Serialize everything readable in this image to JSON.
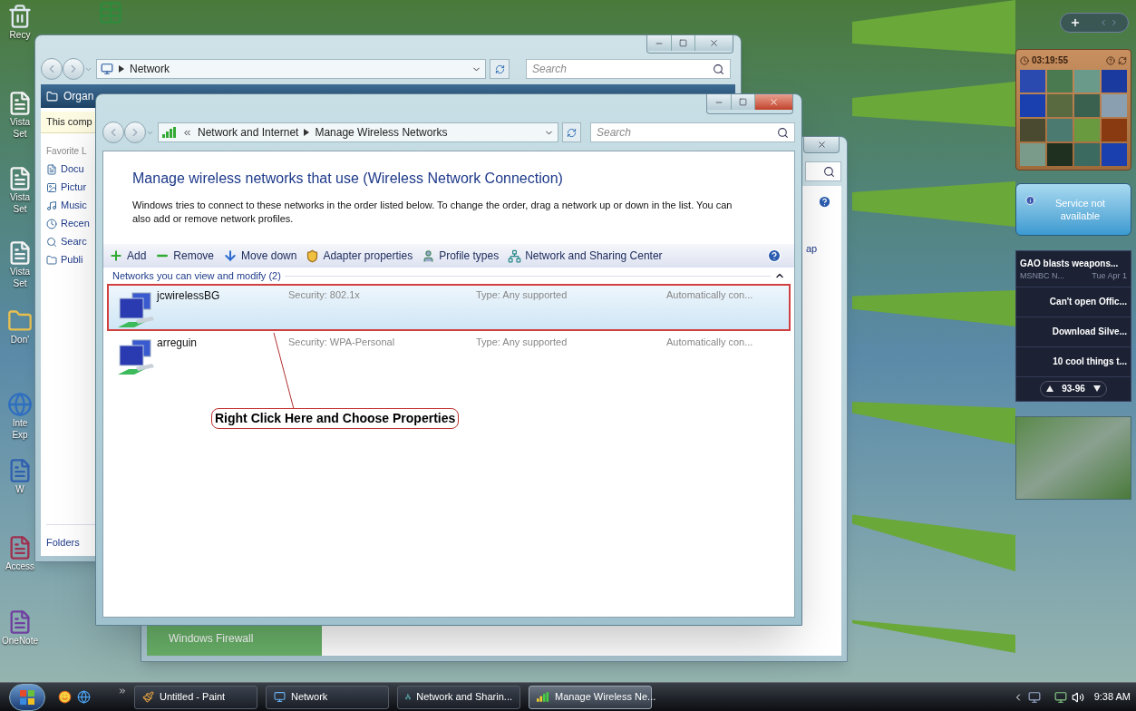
{
  "desktop_icons": [
    {
      "kind": "bin",
      "lines": [
        "Recy"
      ]
    },
    {
      "kind": "sheet"
    },
    {
      "kind": "file",
      "lines": [
        "Vista",
        "Set"
      ]
    },
    {
      "kind": "file",
      "lines": [
        "Vista",
        "Set"
      ]
    },
    {
      "kind": "file",
      "lines": [
        "Vista",
        "Set"
      ]
    },
    {
      "kind": "folder",
      "lines": [
        "Don'"
      ]
    },
    {
      "kind": "browser",
      "lines": [
        "Inte",
        "Exp"
      ]
    },
    {
      "kind": "word",
      "lines": [
        "W"
      ]
    },
    {
      "kind": "access",
      "lines": [
        "Access"
      ]
    },
    {
      "kind": "onenote",
      "lines": [
        "OneNote"
      ]
    }
  ],
  "network_window": {
    "address": "Network",
    "search_placeholder": "Search",
    "toolbar_item": "Organ",
    "info_bar": "This comp",
    "favorites_header": "Favorite L",
    "favorites": [
      {
        "kind": "documents",
        "label": "Docu"
      },
      {
        "kind": "pictures",
        "label": "Pictur"
      },
      {
        "kind": "music",
        "label": "Music"
      },
      {
        "kind": "recent",
        "label": "Recen"
      },
      {
        "kind": "searches",
        "label": "Searc"
      },
      {
        "kind": "public",
        "label": "Publi"
      }
    ],
    "folders": "Folders"
  },
  "sharing_window": {
    "side_text": "ap",
    "task": "Windows Firewall"
  },
  "wireless_window": {
    "breadcrumb": [
      "Network and Internet",
      "Manage Wireless Networks"
    ],
    "search_placeholder": "Search",
    "heading": "Manage wireless networks that use (Wireless Network Connection)",
    "description": "Windows tries to connect to these networks in the order listed below. To change the order, drag a network up or down in the list. You can also add or remove network profiles.",
    "toolbar": [
      {
        "kind": "add",
        "label": "Add"
      },
      {
        "kind": "remove",
        "label": "Remove"
      },
      {
        "kind": "move",
        "label": "Move down"
      },
      {
        "kind": "adapter",
        "label": "Adapter properties"
      },
      {
        "kind": "profile",
        "label": "Profile types"
      },
      {
        "kind": "sharing",
        "label": "Network and Sharing Center"
      }
    ],
    "group": {
      "title": "Networks you can view and modify (2)",
      "expanded": true
    },
    "networks": [
      {
        "name": "jcwirelessBG",
        "security": "Security: 802.1x",
        "type": "Type: Any supported",
        "mode": "Automatically con...",
        "selected": true,
        "annotated": true
      },
      {
        "name": "arreguin",
        "security": "Security: WPA-Personal",
        "type": "Type: Any supported",
        "mode": "Automatically con...",
        "selected": false,
        "annotated": false
      }
    ],
    "callout": "Right Click Here and Choose Properties"
  },
  "gadgets": {
    "puzzle": {
      "timer": "03:19:55"
    },
    "weather": {
      "message": "Service not available"
    },
    "feed": {
      "headline": "GAO blasts weapons...",
      "source": "MSNBC N...",
      "date": "Tue Apr 1",
      "items": [
        "Can't open Offic...",
        "Download Silve...",
        "10 cool things t..."
      ],
      "range": "93-96"
    }
  },
  "taskbar": {
    "tasks": [
      {
        "kind": "paint",
        "label": "Untitled - Paint",
        "selected": false
      },
      {
        "kind": "network",
        "label": "Network",
        "selected": false
      },
      {
        "kind": "sharing",
        "label": "Network and Sharin...",
        "selected": false
      },
      {
        "kind": "wireless",
        "label": "Manage Wireless Ne...",
        "selected": true
      }
    ],
    "clock": "9:38 AM"
  }
}
